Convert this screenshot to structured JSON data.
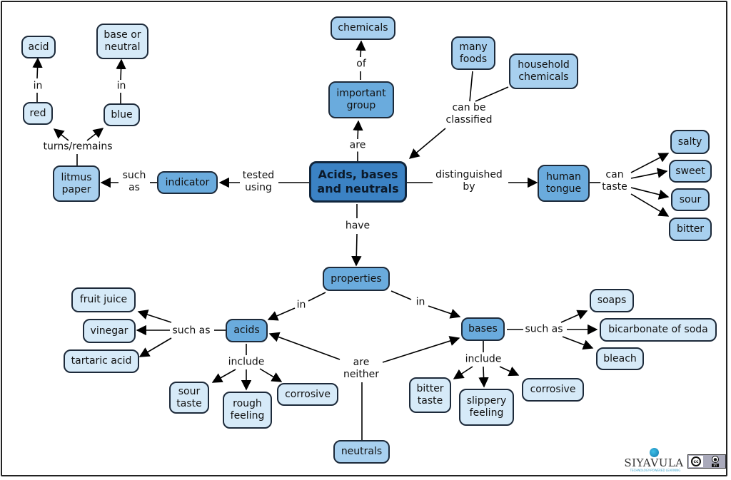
{
  "title": "Acids, bases and neutrals",
  "nodes": {
    "main": "Acids, bases\nand neutrals",
    "chemicals": "chemicals",
    "important_group": "important\ngroup",
    "many_foods": "many\nfoods",
    "household_chemicals": "household\nchemicals",
    "acid": "acid",
    "base_or_neutral": "base or\nneutral",
    "red": "red",
    "blue": "blue",
    "litmus_paper": "litmus\npaper",
    "indicator": "indicator",
    "human_tongue": "human\ntongue",
    "salty": "salty",
    "sweet": "sweet",
    "sour": "sour",
    "bitter": "bitter",
    "properties": "properties",
    "acids": "acids",
    "bases": "bases",
    "neutrals": "neutrals",
    "fruit_juice": "fruit juice",
    "vinegar": "vinegar",
    "tartaric_acid": "tartaric acid",
    "sour_taste": "sour\ntaste",
    "rough_feeling": "rough\nfeeling",
    "corrosive_acid": "corrosive",
    "soaps": "soaps",
    "bicarbonate": "bicarbonate of soda",
    "bleach": "bleach",
    "bitter_taste": "bitter\ntaste",
    "slippery_feeling": "slippery\nfeeling",
    "corrosive_base": "corrosive"
  },
  "links": {
    "of": "of",
    "are": "are",
    "can_be_classified": "can be\nclassified",
    "in_acid": "in",
    "in_base": "in",
    "turns_remains": "turns/remains",
    "such_as_litmus": "such\nas",
    "tested_using": "tested\nusing",
    "distinguished_by": "distinguished\nby",
    "can_taste": "can\ntaste",
    "have": "have",
    "in_left": "in",
    "in_right": "in",
    "such_as_acids": "such as",
    "include_acids": "include",
    "are_neither": "are\nneither",
    "such_as_bases": "such as",
    "include_bases": "include"
  },
  "branding": {
    "logo_text": "SIYAVULA",
    "logo_sub": "TECHNOLOGY-POWERED LEARNING",
    "license": "BY",
    "license_cc": "cc"
  }
}
